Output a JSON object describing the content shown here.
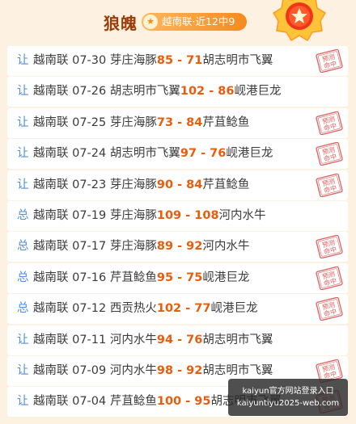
{
  "header": {
    "title": "狼魄",
    "badge": "越南联·近12中9"
  },
  "rows": [
    {
      "tag": "让",
      "league": "越南联",
      "date": "07-30",
      "home": "芽庄海豚",
      "home_score": "85",
      "away_score": "71",
      "away": "胡志明市飞翼",
      "hit": true
    },
    {
      "tag": "让",
      "league": "越南联",
      "date": "07-26",
      "home": "胡志明市飞翼",
      "home_score": "102",
      "away_score": "86",
      "away": "岘港巨龙",
      "hit": false
    },
    {
      "tag": "让",
      "league": "越南联",
      "date": "07-25",
      "home": "芽庄海豚",
      "home_score": "73",
      "away_score": "84",
      "away": "芹苴鲶鱼",
      "hit": true
    },
    {
      "tag": "让",
      "league": "越南联",
      "date": "07-24",
      "home": "胡志明市飞翼",
      "home_score": "97",
      "away_score": "76",
      "away": "岘港巨龙",
      "hit": true
    },
    {
      "tag": "让",
      "league": "越南联",
      "date": "07-23",
      "home": "芽庄海豚",
      "home_score": "90",
      "away_score": "84",
      "away": "芹苴鲶鱼",
      "hit": true
    },
    {
      "tag": "总",
      "league": "越南联",
      "date": "07-19",
      "home": "芽庄海豚",
      "home_score": "109",
      "away_score": "108",
      "away": "河内水牛",
      "hit": false
    },
    {
      "tag": "总",
      "league": "越南联",
      "date": "07-17",
      "home": "芽庄海豚",
      "home_score": "89",
      "away_score": "92",
      "away": "河内水牛",
      "hit": true
    },
    {
      "tag": "总",
      "league": "越南联",
      "date": "07-16",
      "home": "芹苴鲶鱼",
      "home_score": "95",
      "away_score": "75",
      "away": "岘港巨龙",
      "hit": true
    },
    {
      "tag": "总",
      "league": "越南联",
      "date": "07-12",
      "home": "西贡热火",
      "home_score": "102",
      "away_score": "77",
      "away": "岘港巨龙",
      "hit": true
    },
    {
      "tag": "让",
      "league": "越南联",
      "date": "07-11",
      "home": "河内水牛",
      "home_score": "94",
      "away_score": "76",
      "away": "胡志明市飞翼",
      "hit": false
    },
    {
      "tag": "让",
      "league": "越南联",
      "date": "07-09",
      "home": "河内水牛",
      "home_score": "98",
      "away_score": "92",
      "away": "胡志明市飞翼",
      "hit": true
    },
    {
      "tag": "让",
      "league": "越南联",
      "date": "07-04",
      "home": "芹苴鲶鱼",
      "home_score": "100",
      "away_score": "95",
      "away": "胡志明市飞翼",
      "hit": true
    }
  ],
  "stamp": {
    "line1": "预测",
    "line2": "命中"
  },
  "watermark": {
    "line1": "kaiyun官方网站登录入口",
    "line2": "kaiyuntiyu2025-web.com"
  },
  "colors": {
    "accent": "#f58a1f",
    "score": "#e85d0c",
    "tag": "#4f8fe0",
    "title": "#9c3d08",
    "stamp": "#e06060"
  }
}
